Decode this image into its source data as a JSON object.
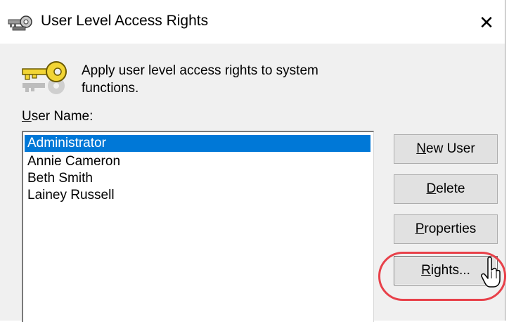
{
  "window": {
    "title": "User Level Access Rights",
    "close_label": "✕"
  },
  "description": "Apply user level access rights to system functions.",
  "user_name": {
    "label_underlined": "U",
    "label_rest": "ser Name:"
  },
  "users": [
    {
      "name": "Administrator",
      "selected": true
    },
    {
      "name": "Annie Cameron",
      "selected": false
    },
    {
      "name": "Beth Smith",
      "selected": false
    },
    {
      "name": "Lainey Russell",
      "selected": false
    }
  ],
  "buttons": {
    "new_user": {
      "mnemonic": "N",
      "rest": "ew User"
    },
    "delete": {
      "mnemonic": "D",
      "rest": "elete"
    },
    "properties": {
      "mnemonic": "P",
      "rest": "roperties"
    },
    "rights": {
      "mnemonic": "R",
      "rest": "ights..."
    }
  },
  "colors": {
    "selection": "#0078d7",
    "highlight_ring": "#e8414a"
  },
  "icons": {
    "title": "keys-icon",
    "header": "key-icon",
    "cursor": "hand-pointer-icon"
  }
}
